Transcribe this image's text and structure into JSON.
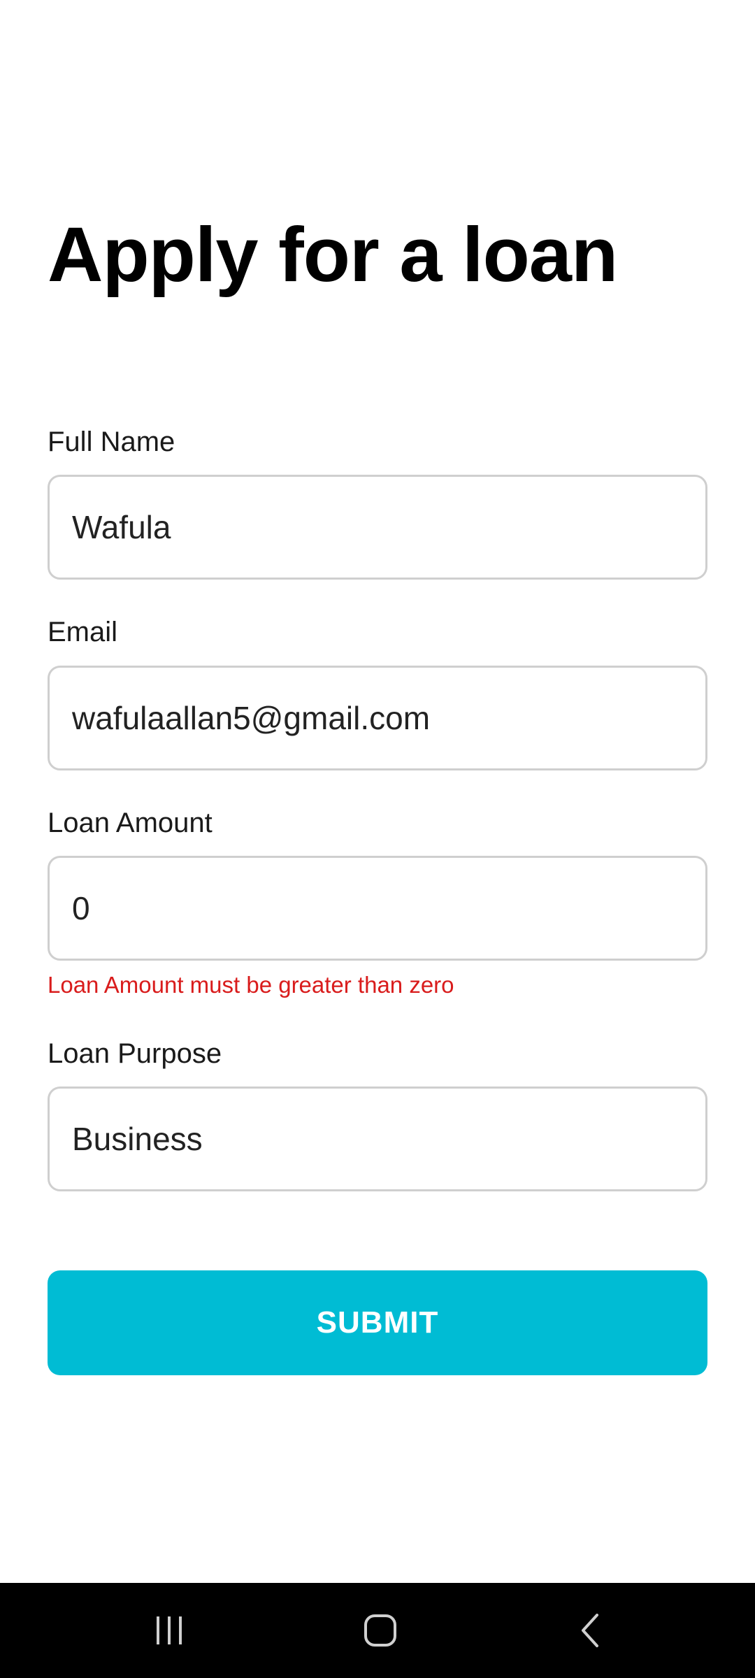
{
  "form": {
    "title": "Apply for a loan",
    "full_name": {
      "label": "Full Name",
      "value": "Wafula"
    },
    "email": {
      "label": "Email",
      "value": "wafulaallan5@gmail.com"
    },
    "loan_amount": {
      "label": "Loan Amount",
      "value": "0",
      "error": "Loan Amount must be greater than zero"
    },
    "loan_purpose": {
      "label": "Loan Purpose",
      "value": "Business"
    },
    "submit_label": "SUBMIT"
  },
  "colors": {
    "accent": "#00bcd4",
    "error": "#d91c1c",
    "field_border": "#cfcfcf",
    "navbar": "#000000"
  },
  "navbar": {
    "icons": [
      "recent-apps-icon",
      "home-icon",
      "back-icon"
    ]
  }
}
